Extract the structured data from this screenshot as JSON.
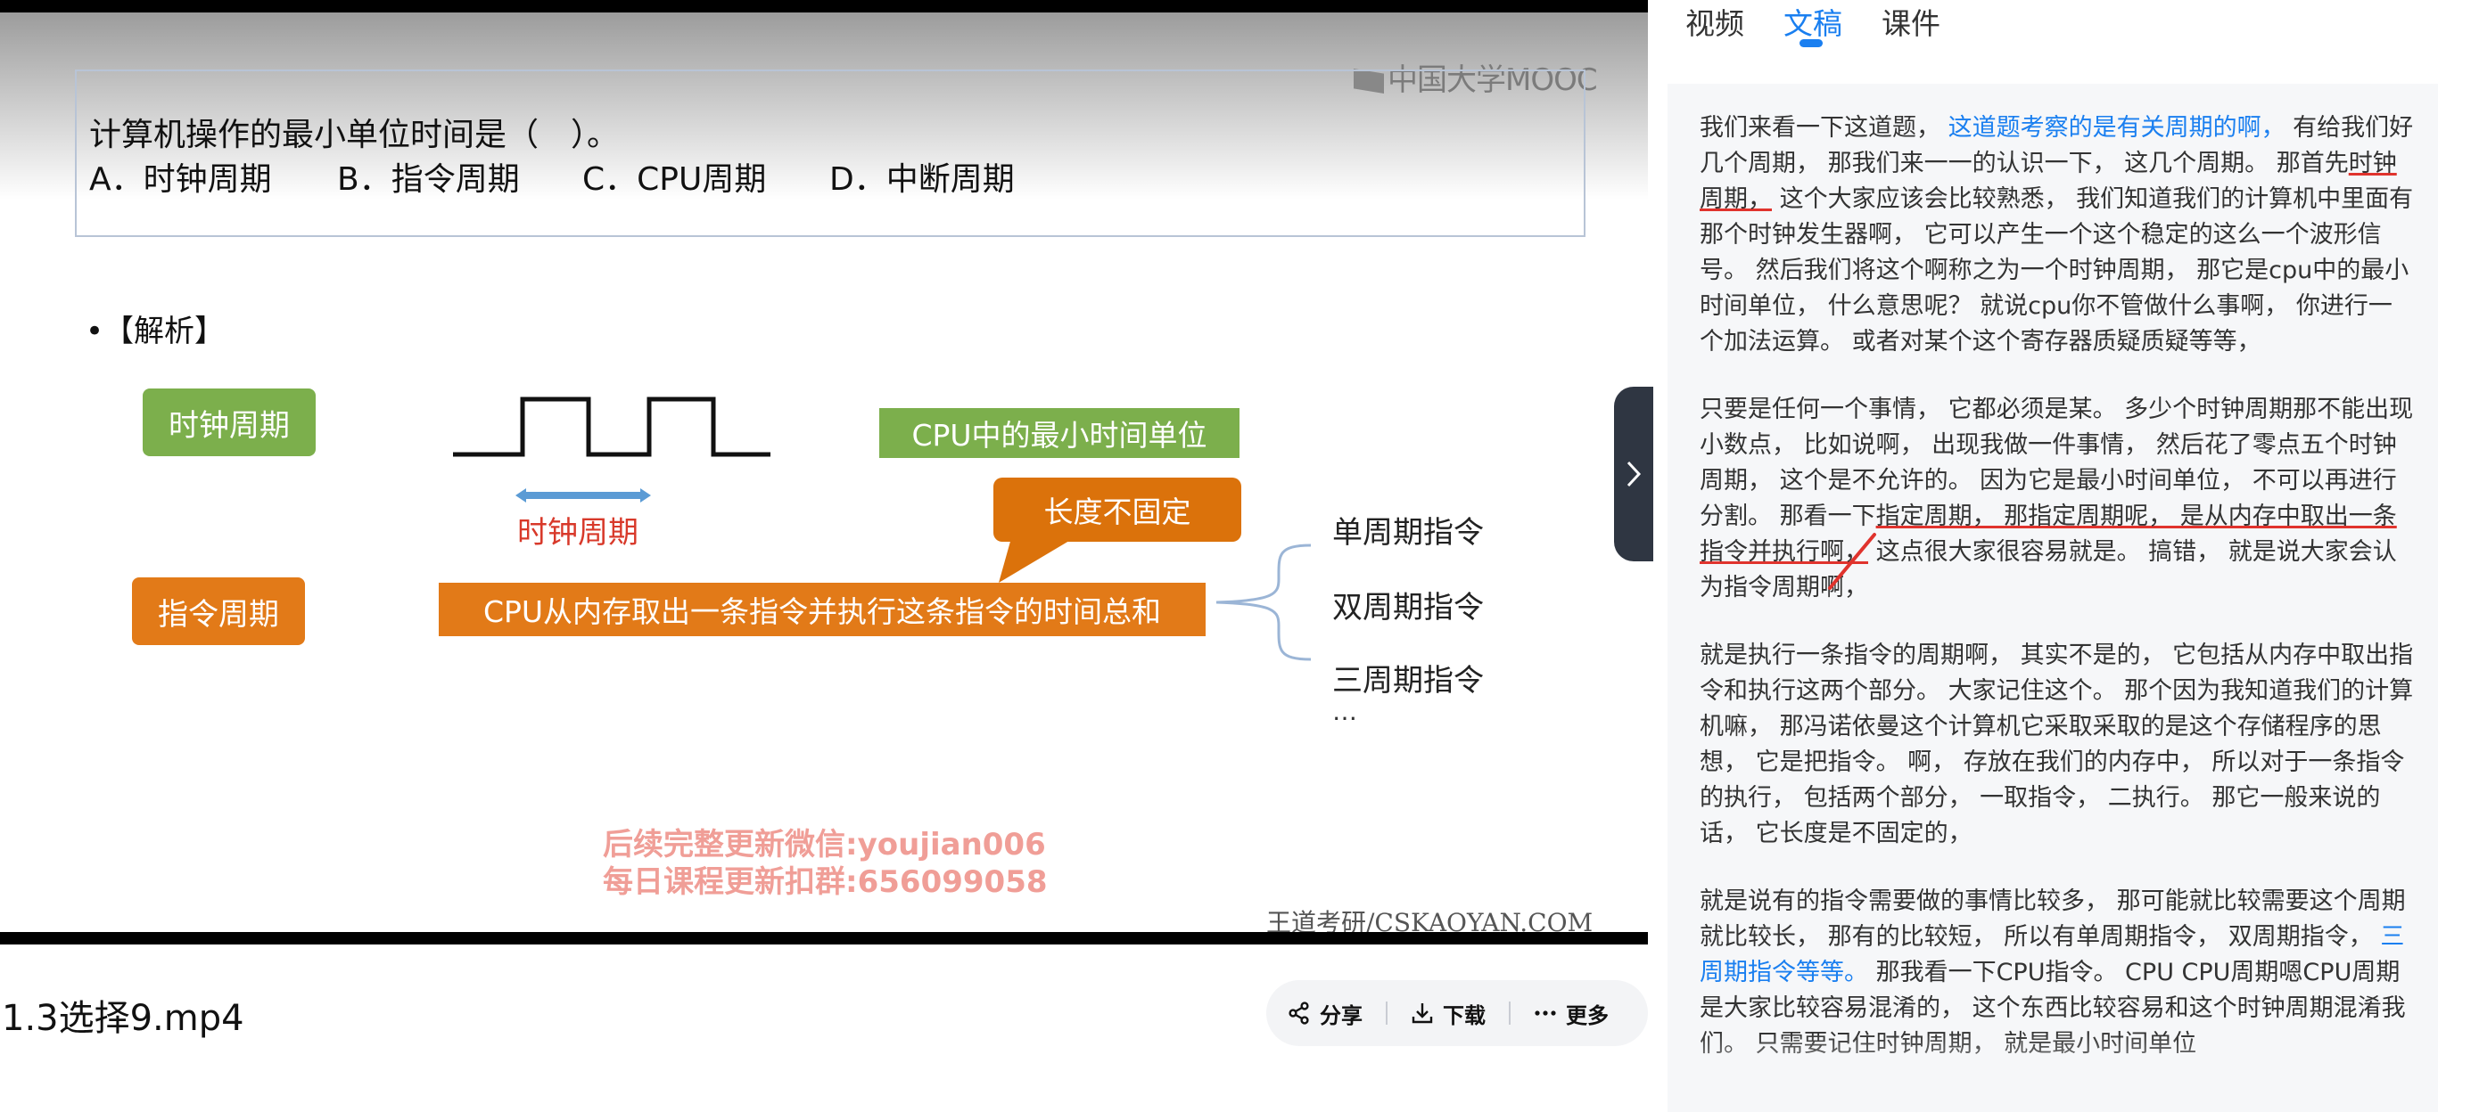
{
  "video": {
    "brand": "中国大学MOOC",
    "question": {
      "text": "计算机操作的最小单位时间是（　）。",
      "options": [
        "A．时钟周期",
        "B．指令周期",
        "C．CPU周期",
        "D．中断周期"
      ]
    },
    "analysis_label": "•【解析】",
    "diagram": {
      "clock_cycle_chip": "时钟周期",
      "instruction_cycle_chip": "指令周期",
      "min_unit_box": "CPU中的最小时间单位",
      "clock_cycle_label": "时钟周期",
      "length_box": "长度不固定",
      "definition_box": "CPU从内存取出一条指令并执行这条指令的时间总和",
      "instruction_types": [
        "单周期指令",
        "双周期指令",
        "三周期指令"
      ],
      "more": "…"
    },
    "watermark": [
      "后续完整更新微信:youjian006",
      "每日课程更新扣群:656099058"
    ],
    "site": "王道考研/CSKAOYAN.COM",
    "colors": {
      "green": "#7caf4c",
      "orange": "#e27a18",
      "watermark": "#f09e97"
    }
  },
  "file": {
    "name": "1.3选择9.mp4"
  },
  "actions": {
    "share": "分享",
    "download": "下载",
    "more": "更多"
  },
  "tabs": [
    {
      "label": "视频",
      "active": false
    },
    {
      "label": "文稿",
      "active": true
    },
    {
      "label": "课件",
      "active": false
    }
  ],
  "transcript": {
    "p1": {
      "a": "我们来看一下这道题， ",
      "hl": "这道题考察的是有关周期的啊，",
      "b": " 有给我们好几个周期， 那我们来一一的认识一下， 这几个周期。 那首先",
      "ul": "时钟周期，",
      "c": " 这个大家应该会比较熟悉， 我们知道我们的计算机中里面有那个时钟发生器啊， 它可以产生一个这个稳定的这么一个波形信号。 然后我们将这个啊称之为一个时钟周期， 那它是cpu中的最小时间单位， 什么意思呢？ 就说cpu你不管做什么事啊， 你进行一个加法运算。 或者对某个这个寄存器质疑质疑等等，"
    },
    "p2": {
      "a": "只要是任何一个事情， 它都必须是某。 多少个时钟周期那不能出现小数点， 比如说啊， 出现我做一件事情， 然后花了零点五个时钟周期， 这个是不允许的。 因为它是最小时间单位， 不可以再进行分割。 那看一下",
      "ul": "指定周期， 那指定周期呢， 是从内存中取出一条指令并执行啊，",
      "b": " 这点很大家很容易就是。 搞错， 就是说大家会认为指令周期啊，"
    },
    "p3": "就是执行一条指令的周期啊， 其实不是的， 它包括从内存中取出指令和执行这两个部分。 大家记住这个。 那个因为我知道我们的计算机嘛， 那冯诺依曼这个计算机它采取采取的是这个存储程序的思想， 它是把指令。 啊， 存放在我们的内存中， 所以对于一条指令的执行， 包括两个部分， 一取指令， 二执行。 那它一般来说的话， 它长度是不固定的，",
    "p4": {
      "a": "就是说有的指令需要做的事情比较多， 那可能就比较需要这个周期就比较长， 那有的比较短， 所以有单周期指令， 双周期指令， ",
      "hl": "三周期指令等等。",
      "b": " 那我看一下CPU指令。 CPU CPU周期嗯CPU周期是大家比较容易混淆的， 这个东西比较容易和这个时钟周期混淆我们。 只需要记住时钟周期， 就是最小时间单位"
    }
  }
}
